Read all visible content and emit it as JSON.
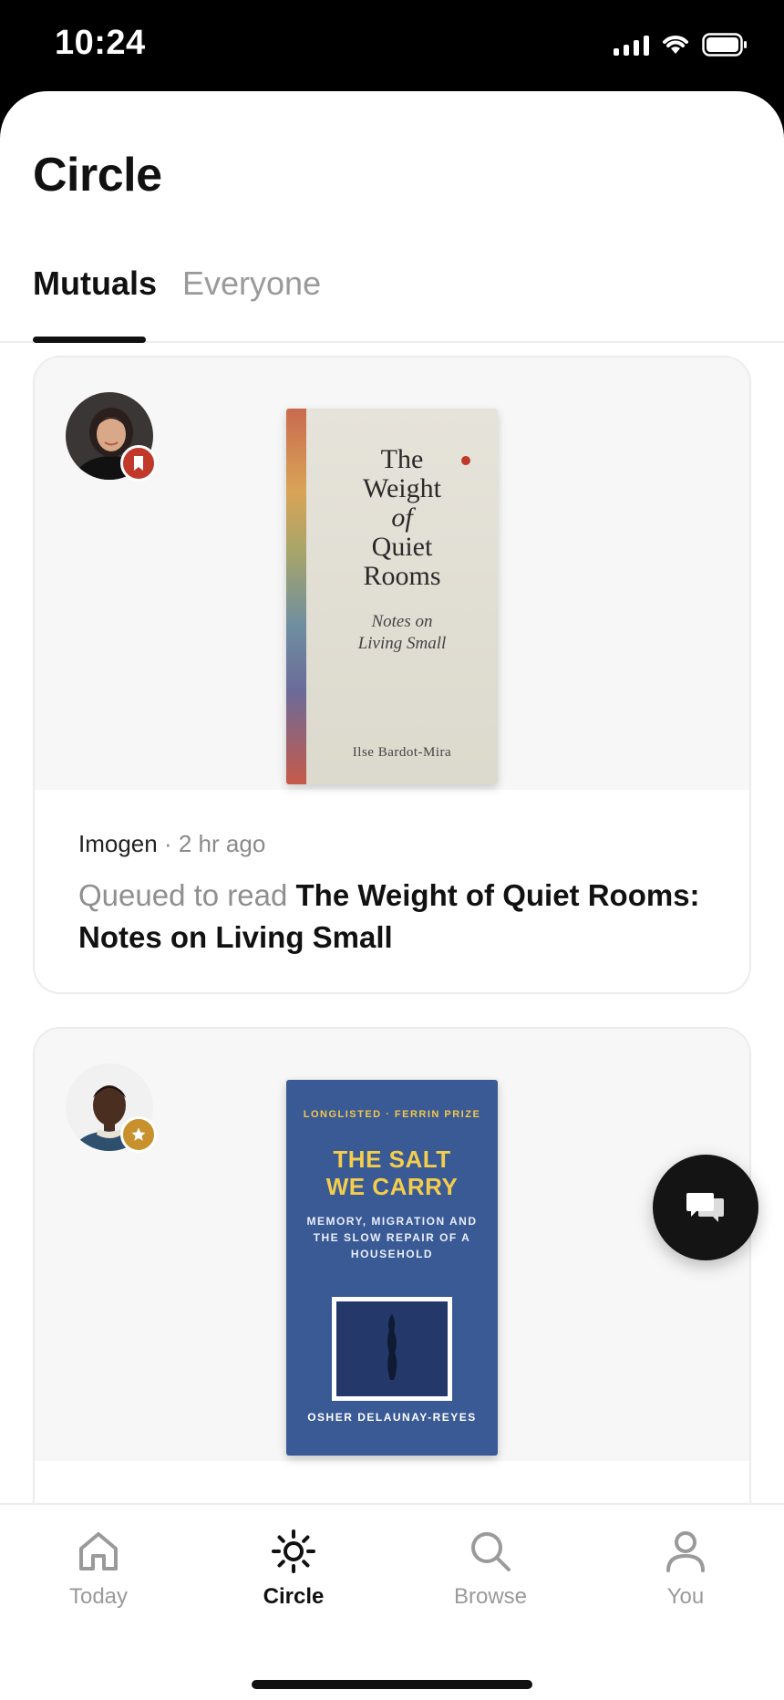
{
  "status_bar": {
    "time": "10:24"
  },
  "header": {
    "title": "Circle"
  },
  "tabs": [
    {
      "label": "Mutuals",
      "active": true
    },
    {
      "label": "Everyone",
      "active": false
    }
  ],
  "feed": [
    {
      "user": "Imogen",
      "time_ago": "2 hr ago",
      "separator": "·",
      "verb": "Queued to read",
      "book_title": "The Weight of Quiet Rooms: Notes on Living Small",
      "badge": "bookmark-icon",
      "cover": {
        "title_line1": "The",
        "title_line2": "Weight",
        "title_line3": "of",
        "title_line4": "Quiet",
        "title_line5": "Rooms",
        "subtitle_line1": "Notes on",
        "subtitle_line2": "Living Small",
        "author": "Ilse Bardot-Mira"
      }
    },
    {
      "badge": "star-icon",
      "cover": {
        "eyebrow": "LONGLISTED · FERRIN PRIZE",
        "title_line1": "THE SALT",
        "title_line2": "WE CARRY",
        "subtitle": "MEMORY, MIGRATION AND THE SLOW REPAIR OF A HOUSEHOLD",
        "author": "OSHER DELAUNAY-REYES"
      }
    }
  ],
  "tabbar": [
    {
      "label": "Today",
      "icon": "home-icon",
      "active": false
    },
    {
      "label": "Circle",
      "icon": "sun-icon",
      "active": true
    },
    {
      "label": "Browse",
      "icon": "search-icon",
      "active": false
    },
    {
      "label": "You",
      "icon": "person-icon",
      "active": false
    }
  ],
  "colors": {
    "accent_red": "#c0392b",
    "accent_gold": "#c8912e",
    "book2_blue": "#3a5a96"
  }
}
